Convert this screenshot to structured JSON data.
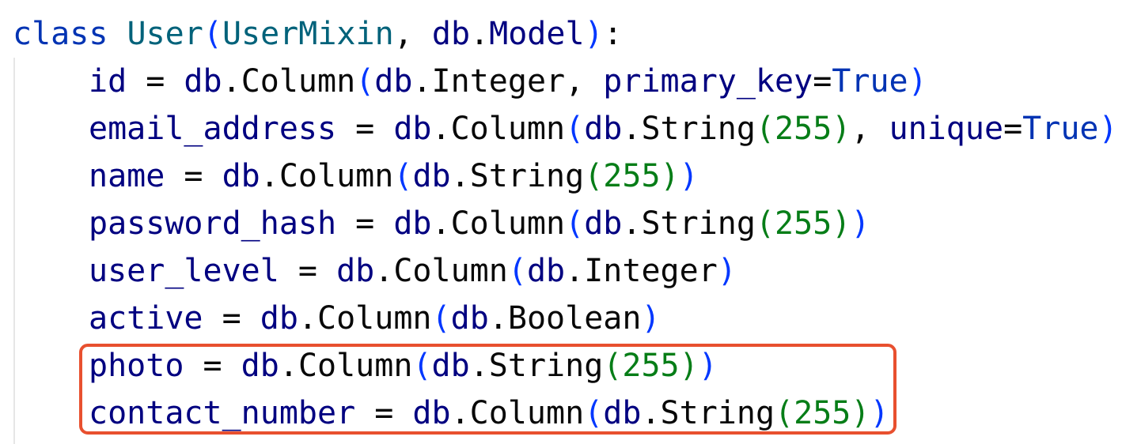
{
  "colors": {
    "keyword": "#0033b3",
    "class_name": "#00627a",
    "identifier": "#000080",
    "bracket": "#0037ff",
    "number": "#067d17",
    "operator": "#080808",
    "highlight_border": "#e8502f",
    "indent_guide": "#e6e6e6"
  },
  "lines": [
    {
      "name": "code-line-class-def",
      "indented": false,
      "tokens": [
        {
          "text": "class",
          "color": "#0033b3"
        },
        {
          "text": " ",
          "color": "#080808"
        },
        {
          "text": "User",
          "color": "#00627a"
        },
        {
          "text": "(",
          "color": "#0037ff"
        },
        {
          "text": "UserMixin",
          "color": "#00627a"
        },
        {
          "text": ", ",
          "color": "#080808"
        },
        {
          "text": "db",
          "color": "#000080"
        },
        {
          "text": ".",
          "color": "#080808"
        },
        {
          "text": "Model",
          "color": "#000080"
        },
        {
          "text": ")",
          "color": "#0037ff"
        },
        {
          "text": ":",
          "color": "#080808"
        }
      ]
    },
    {
      "name": "code-line-id",
      "indented": true,
      "tokens": [
        {
          "text": "id",
          "color": "#000080"
        },
        {
          "text": " = ",
          "color": "#080808"
        },
        {
          "text": "db",
          "color": "#000080"
        },
        {
          "text": ".",
          "color": "#080808"
        },
        {
          "text": "Column",
          "color": "#080808"
        },
        {
          "text": "(",
          "color": "#0037ff"
        },
        {
          "text": "db",
          "color": "#000080"
        },
        {
          "text": ".",
          "color": "#080808"
        },
        {
          "text": "Integer",
          "color": "#080808"
        },
        {
          "text": ", ",
          "color": "#080808"
        },
        {
          "text": "primary_key",
          "color": "#000080"
        },
        {
          "text": "=",
          "color": "#080808"
        },
        {
          "text": "True",
          "color": "#0033b3"
        },
        {
          "text": ")",
          "color": "#0037ff"
        }
      ]
    },
    {
      "name": "code-line-email-address",
      "indented": true,
      "tokens": [
        {
          "text": "email_address",
          "color": "#000080"
        },
        {
          "text": " = ",
          "color": "#080808"
        },
        {
          "text": "db",
          "color": "#000080"
        },
        {
          "text": ".",
          "color": "#080808"
        },
        {
          "text": "Column",
          "color": "#080808"
        },
        {
          "text": "(",
          "color": "#0037ff"
        },
        {
          "text": "db",
          "color": "#000080"
        },
        {
          "text": ".",
          "color": "#080808"
        },
        {
          "text": "String",
          "color": "#080808"
        },
        {
          "text": "(",
          "color": "#067d17"
        },
        {
          "text": "255",
          "color": "#067d17"
        },
        {
          "text": ")",
          "color": "#067d17"
        },
        {
          "text": ", ",
          "color": "#080808"
        },
        {
          "text": "unique",
          "color": "#000080"
        },
        {
          "text": "=",
          "color": "#080808"
        },
        {
          "text": "True",
          "color": "#0033b3"
        },
        {
          "text": ")",
          "color": "#0037ff"
        }
      ]
    },
    {
      "name": "code-line-name",
      "indented": true,
      "tokens": [
        {
          "text": "name",
          "color": "#000080"
        },
        {
          "text": " = ",
          "color": "#080808"
        },
        {
          "text": "db",
          "color": "#000080"
        },
        {
          "text": ".",
          "color": "#080808"
        },
        {
          "text": "Column",
          "color": "#080808"
        },
        {
          "text": "(",
          "color": "#0037ff"
        },
        {
          "text": "db",
          "color": "#000080"
        },
        {
          "text": ".",
          "color": "#080808"
        },
        {
          "text": "String",
          "color": "#080808"
        },
        {
          "text": "(",
          "color": "#067d17"
        },
        {
          "text": "255",
          "color": "#067d17"
        },
        {
          "text": ")",
          "color": "#067d17"
        },
        {
          "text": ")",
          "color": "#0037ff"
        }
      ]
    },
    {
      "name": "code-line-password-hash",
      "indented": true,
      "tokens": [
        {
          "text": "password_hash",
          "color": "#000080"
        },
        {
          "text": " = ",
          "color": "#080808"
        },
        {
          "text": "db",
          "color": "#000080"
        },
        {
          "text": ".",
          "color": "#080808"
        },
        {
          "text": "Column",
          "color": "#080808"
        },
        {
          "text": "(",
          "color": "#0037ff"
        },
        {
          "text": "db",
          "color": "#000080"
        },
        {
          "text": ".",
          "color": "#080808"
        },
        {
          "text": "String",
          "color": "#080808"
        },
        {
          "text": "(",
          "color": "#067d17"
        },
        {
          "text": "255",
          "color": "#067d17"
        },
        {
          "text": ")",
          "color": "#067d17"
        },
        {
          "text": ")",
          "color": "#0037ff"
        }
      ]
    },
    {
      "name": "code-line-user-level",
      "indented": true,
      "tokens": [
        {
          "text": "user_level",
          "color": "#000080"
        },
        {
          "text": " = ",
          "color": "#080808"
        },
        {
          "text": "db",
          "color": "#000080"
        },
        {
          "text": ".",
          "color": "#080808"
        },
        {
          "text": "Column",
          "color": "#080808"
        },
        {
          "text": "(",
          "color": "#0037ff"
        },
        {
          "text": "db",
          "color": "#000080"
        },
        {
          "text": ".",
          "color": "#080808"
        },
        {
          "text": "Integer",
          "color": "#080808"
        },
        {
          "text": ")",
          "color": "#0037ff"
        }
      ]
    },
    {
      "name": "code-line-active",
      "indented": true,
      "tokens": [
        {
          "text": "active",
          "color": "#000080"
        },
        {
          "text": " = ",
          "color": "#080808"
        },
        {
          "text": "db",
          "color": "#000080"
        },
        {
          "text": ".",
          "color": "#080808"
        },
        {
          "text": "Column",
          "color": "#080808"
        },
        {
          "text": "(",
          "color": "#0037ff"
        },
        {
          "text": "db",
          "color": "#000080"
        },
        {
          "text": ".",
          "color": "#080808"
        },
        {
          "text": "Boolean",
          "color": "#080808"
        },
        {
          "text": ")",
          "color": "#0037ff"
        }
      ]
    },
    {
      "name": "code-line-photo",
      "indented": true,
      "tokens": [
        {
          "text": "photo",
          "color": "#000080"
        },
        {
          "text": " = ",
          "color": "#080808"
        },
        {
          "text": "db",
          "color": "#000080"
        },
        {
          "text": ".",
          "color": "#080808"
        },
        {
          "text": "Column",
          "color": "#080808"
        },
        {
          "text": "(",
          "color": "#0037ff"
        },
        {
          "text": "db",
          "color": "#000080"
        },
        {
          "text": ".",
          "color": "#080808"
        },
        {
          "text": "String",
          "color": "#080808"
        },
        {
          "text": "(",
          "color": "#067d17"
        },
        {
          "text": "255",
          "color": "#067d17"
        },
        {
          "text": ")",
          "color": "#067d17"
        },
        {
          "text": ")",
          "color": "#0037ff"
        }
      ]
    },
    {
      "name": "code-line-contact-number",
      "indented": true,
      "tokens": [
        {
          "text": "contact_number",
          "color": "#000080"
        },
        {
          "text": " = ",
          "color": "#080808"
        },
        {
          "text": "db",
          "color": "#000080"
        },
        {
          "text": ".",
          "color": "#080808"
        },
        {
          "text": "Column",
          "color": "#080808"
        },
        {
          "text": "(",
          "color": "#0037ff"
        },
        {
          "text": "db",
          "color": "#000080"
        },
        {
          "text": ".",
          "color": "#080808"
        },
        {
          "text": "String",
          "color": "#080808"
        },
        {
          "text": "(",
          "color": "#067d17"
        },
        {
          "text": "255",
          "color": "#067d17"
        },
        {
          "text": ")",
          "color": "#067d17"
        },
        {
          "text": ")",
          "color": "#0037ff"
        }
      ]
    }
  ]
}
